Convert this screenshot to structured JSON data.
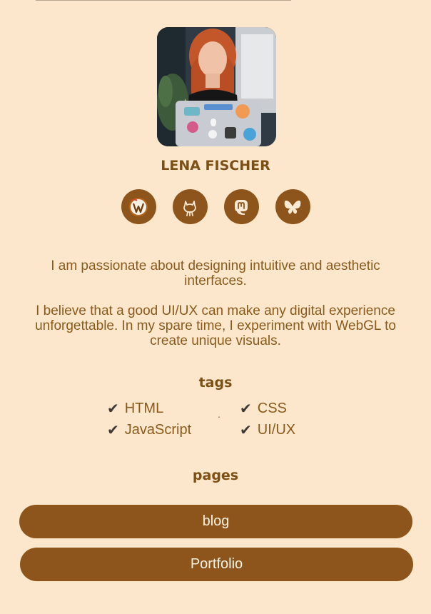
{
  "profile": {
    "name": "LENA FISCHER",
    "avatar_alt": "Portrait of Lena Fischer"
  },
  "socials": [
    {
      "icon": "wordpress-icon",
      "label": "WordPress"
    },
    {
      "icon": "github-icon",
      "label": "GitHub"
    },
    {
      "icon": "mastodon-icon",
      "label": "Mastodon"
    },
    {
      "icon": "bluesky-icon",
      "label": "Bluesky"
    }
  ],
  "bio": {
    "p1": "I am passionate about designing intuitive and aesthetic interfaces.",
    "p2": "I believe that a good UI/UX can make any digital experience unforgettable. In my spare time, I experiment with WebGL to create unique visuals."
  },
  "tags_section": {
    "title": "tags",
    "separator": ".",
    "items": [
      "HTML",
      "CSS",
      "JavaScript",
      "UI/UX"
    ],
    "check_glyph": "✔"
  },
  "pages_section": {
    "title": "pages",
    "items": [
      "blog",
      "Portfolio"
    ]
  },
  "colors": {
    "background": "#fce7cc",
    "brand_brown": "#8d551c",
    "text": "#8a5a1c",
    "button_text": "#fff3e2"
  }
}
